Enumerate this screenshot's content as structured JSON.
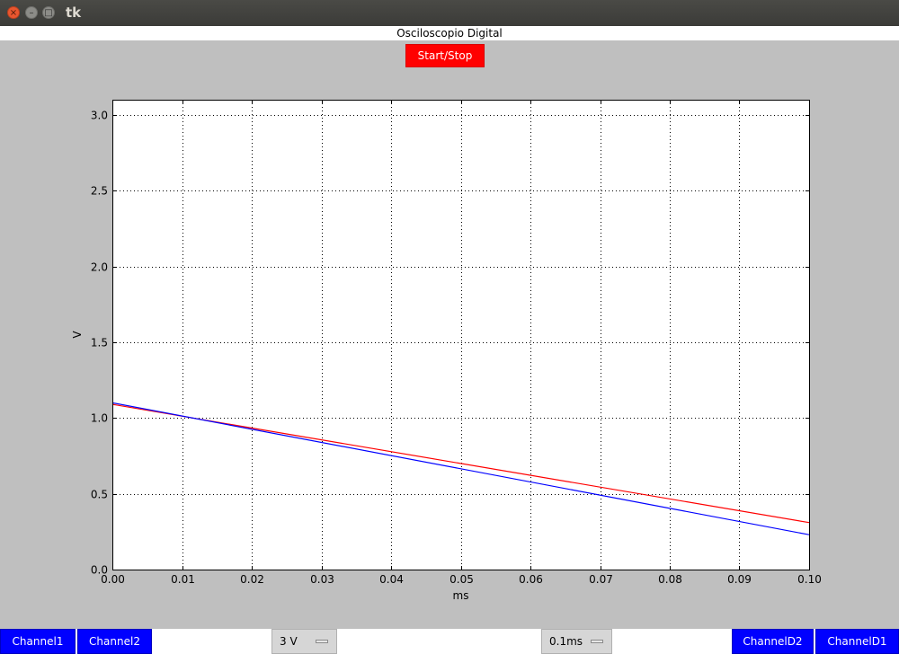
{
  "window": {
    "title": "tk",
    "close_glyph": "×",
    "minimize_glyph": "–",
    "maximize_glyph": "□"
  },
  "app": {
    "title": "Osciloscopio Digital",
    "start_stop_label": "Start/Stop"
  },
  "controls": {
    "channel1_label": "Channel1",
    "channel2_label": "Channel2",
    "voltage_scale": "3 V",
    "time_scale": "0.1ms",
    "channeld2_label": "ChannelD2",
    "channeld1_label": "ChannelD1"
  },
  "colors": {
    "start_stop_bg": "#ff0000",
    "channel_button_bg": "#0000ff",
    "series_red": "#ff0000",
    "series_blue": "#0000ff"
  },
  "chart_data": {
    "type": "line",
    "title": "",
    "xlabel": "ms",
    "ylabel": "V",
    "xlim": [
      0,
      0.1
    ],
    "ylim": [
      0,
      3.1
    ],
    "xticks": [
      "0.00",
      "0.01",
      "0.02",
      "0.03",
      "0.04",
      "0.05",
      "0.06",
      "0.07",
      "0.08",
      "0.09",
      "0.10"
    ],
    "yticks": [
      "0.0",
      "0.5",
      "1.0",
      "1.5",
      "2.0",
      "2.5",
      "3.0"
    ],
    "grid": true,
    "series": [
      {
        "color": "#ff0000",
        "x": [
          0,
          0.1
        ],
        "y": [
          1.09,
          0.31
        ]
      },
      {
        "color": "#0000ff",
        "x": [
          0,
          0.1
        ],
        "y": [
          1.1,
          0.23
        ]
      }
    ]
  }
}
